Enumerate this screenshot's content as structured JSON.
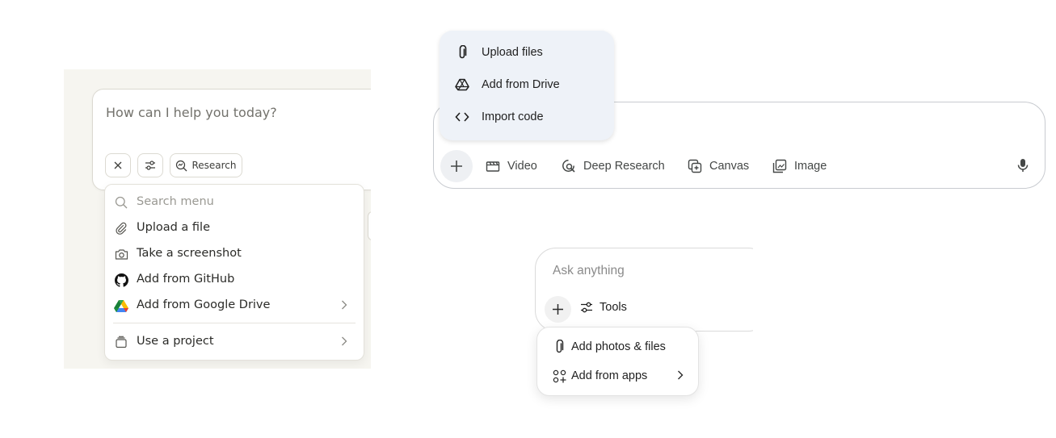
{
  "panel_claude": {
    "placeholder": "How can I help you today?",
    "research_label": "Research",
    "search_placeholder": "Search menu",
    "menu_items": [
      {
        "label": "Upload a file",
        "icon": "paperclip-icon"
      },
      {
        "label": "Take a screenshot",
        "icon": "camera-icon"
      },
      {
        "label": "Add from GitHub",
        "icon": "github-icon"
      },
      {
        "label": "Add from Google Drive",
        "icon": "google-drive-icon"
      },
      {
        "label": "Use a project",
        "icon": "project-icon"
      }
    ],
    "colors": {
      "background": "#f6f5f0",
      "border": "#dcdad2"
    }
  },
  "panel_gemini": {
    "menu_items": [
      {
        "label": "Upload files",
        "icon": "paperclip-icon"
      },
      {
        "label": "Add from Drive",
        "icon": "drive-icon"
      },
      {
        "label": "Import code",
        "icon": "code-icon"
      }
    ],
    "toolbar": [
      {
        "label": "Video",
        "icon": "video-icon"
      },
      {
        "label": "Deep Research",
        "icon": "deep-research-icon"
      },
      {
        "label": "Canvas",
        "icon": "canvas-icon"
      },
      {
        "label": "Image",
        "icon": "image-icon"
      }
    ],
    "colors": {
      "menu_background": "#eef2f8",
      "plus_background": "#eef0f3"
    }
  },
  "panel_chatgpt": {
    "placeholder": "Ask anything",
    "tools_label": "Tools",
    "menu_items": [
      {
        "label": "Add photos & files",
        "icon": "paperclip-icon"
      },
      {
        "label": "Add from apps",
        "icon": "apps-icon"
      }
    ]
  }
}
